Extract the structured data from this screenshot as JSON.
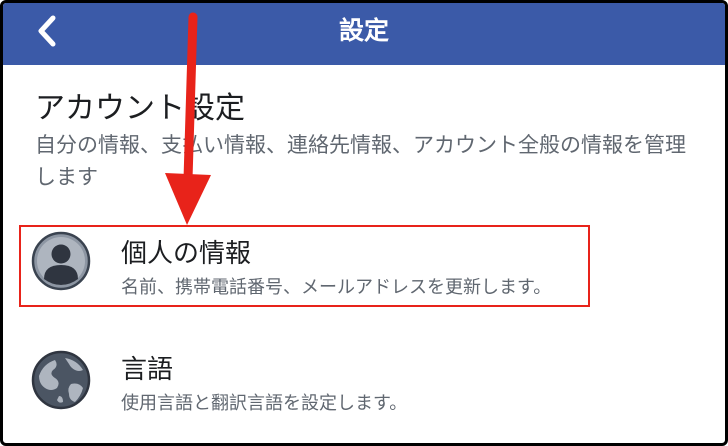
{
  "header": {
    "title": "設定",
    "back_icon": "chevron-left-icon",
    "background": "#3b5aa8"
  },
  "section": {
    "title": "アカウント設定",
    "description": "自分の情報、支払い情報、連絡先情報、アカウント全般の情報を管理します"
  },
  "items": [
    {
      "title": "個人の情報",
      "description": "名前、携帯電話番号、メールアドレスを更新します。",
      "icon": "person-icon"
    },
    {
      "title": "言語",
      "description": "使用言語と翻訳言語を設定します。",
      "icon": "globe-icon"
    }
  ],
  "annotation": {
    "arrow_color": "#e8231a",
    "highlight_color": "#e8231a"
  }
}
